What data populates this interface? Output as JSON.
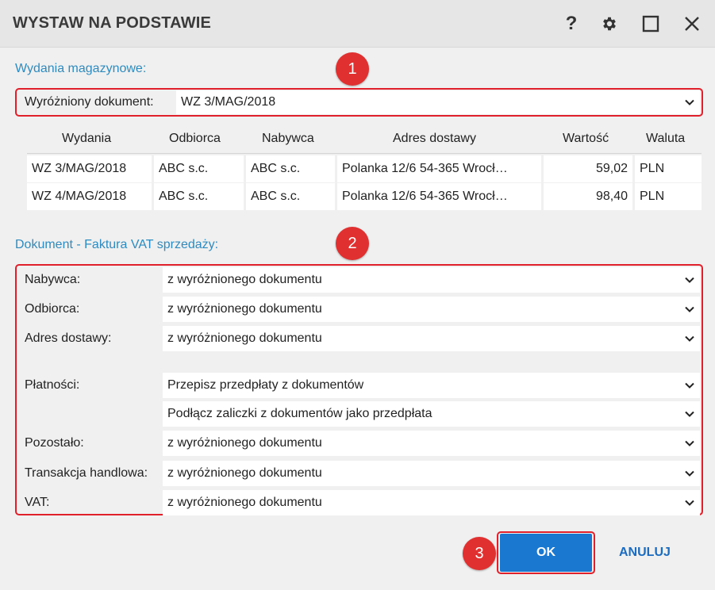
{
  "window": {
    "title": "WYSTAW NA PODSTAWIE",
    "help_glyph": "?"
  },
  "section1": {
    "label": "Wydania magazynowe:",
    "marker": "1",
    "highlighted_label": "Wyróżniony dokument:",
    "highlighted_value": "WZ 3/MAG/2018"
  },
  "grid": {
    "headers": [
      "Wydania",
      "Odbiorca",
      "Nabywca",
      "Adres dostawy",
      "Wartość",
      "Waluta"
    ],
    "rows": [
      [
        "WZ 3/MAG/2018",
        "ABC s.c.",
        "ABC s.c.",
        "Polanka  12/6  54-365 Wrocł…",
        "59,02",
        "PLN"
      ],
      [
        "WZ 4/MAG/2018",
        "ABC s.c.",
        "ABC s.c.",
        "Polanka  12/6  54-365 Wrocł…",
        "98,40",
        "PLN"
      ]
    ]
  },
  "section2": {
    "label": "Dokument - Faktura VAT sprzedaży:",
    "marker": "2",
    "fields": {
      "nabywca": {
        "label": "Nabywca:",
        "value": "z wyróżnionego dokumentu"
      },
      "odbiorca": {
        "label": "Odbiorca:",
        "value": "z wyróżnionego dokumentu"
      },
      "adres": {
        "label": "Adres dostawy:",
        "value": "z wyróżnionego dokumentu"
      },
      "platnosci": {
        "label": "Płatności:",
        "value": "Przepisz przedpłaty z dokumentów"
      },
      "zaliczki": {
        "value": "Podłącz zaliczki z dokumentów jako przedpłata"
      },
      "pozostalo": {
        "label": "Pozostało:",
        "value": "z wyróżnionego dokumentu"
      },
      "transakcja": {
        "label": "Transakcja handlowa:",
        "value": "z wyróżnionego dokumentu"
      },
      "vat": {
        "label": "VAT:",
        "value": "z wyróżnionego dokumentu"
      }
    }
  },
  "footer": {
    "marker": "3",
    "ok_label": "OK",
    "cancel_label": "ANULUJ"
  },
  "colors": {
    "accent": "#2e8bc0",
    "marker": "#e03030",
    "highlight_border": "#e0202a",
    "primary_button": "#1b78d0"
  }
}
